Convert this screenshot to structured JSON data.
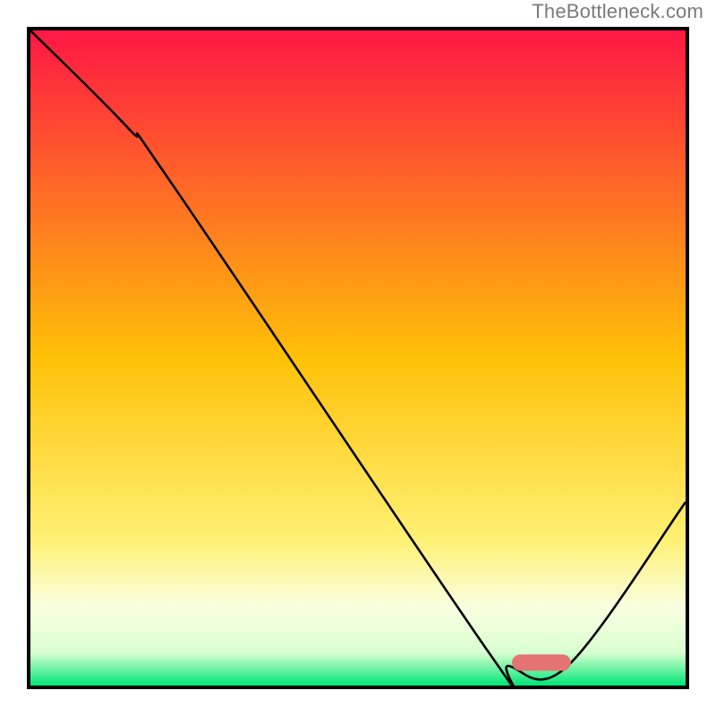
{
  "watermark": "TheBottleneck.com",
  "chart_data": {
    "type": "line",
    "title": "",
    "xlabel": "",
    "ylabel": "",
    "xlim": [
      0,
      100
    ],
    "ylim": [
      0,
      100
    ],
    "gradient_stops": [
      {
        "offset": 0.0,
        "color": "#ff1744"
      },
      {
        "offset": 0.5,
        "color": "#ffc107"
      },
      {
        "offset": 0.78,
        "color": "#fff176"
      },
      {
        "offset": 0.88,
        "color": "#f9ffe0"
      },
      {
        "offset": 0.95,
        "color": "#d9ffd1"
      },
      {
        "offset": 1.0,
        "color": "#00e676"
      }
    ],
    "series": [
      {
        "name": "bottleneck-curve",
        "color": "#000000",
        "stroke_width": 2.6,
        "points": [
          {
            "x": 0,
            "y": 100
          },
          {
            "x": 15,
            "y": 85
          },
          {
            "x": 22,
            "y": 76
          },
          {
            "x": 70,
            "y": 5
          },
          {
            "x": 73,
            "y": 3
          },
          {
            "x": 82,
            "y": 3
          },
          {
            "x": 100,
            "y": 28
          }
        ]
      }
    ],
    "marker": {
      "x_center": 78,
      "y": 3.5,
      "width": 9,
      "height": 2.5,
      "color": "#e57373",
      "rx": 1.3
    }
  }
}
